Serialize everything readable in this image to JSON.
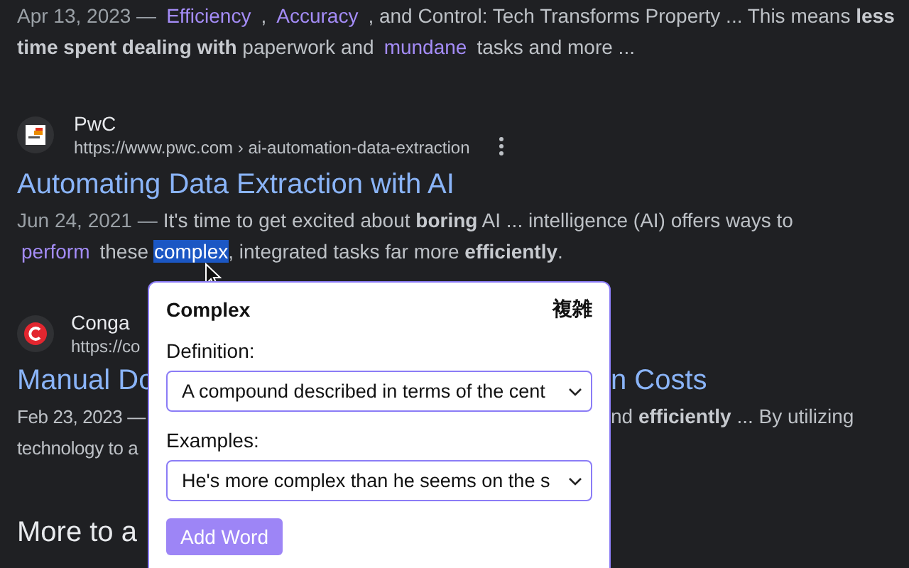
{
  "results": [
    {
      "kind": "snippet_only",
      "lines": [
        [
          {
            "kind": "date",
            "text": "Apr 13, 2023 —"
          },
          {
            "kind": "vocab",
            "text": "Efficiency"
          },
          {
            "kind": "text",
            "text": ","
          },
          {
            "kind": "vocab",
            "text": "Accuracy"
          },
          {
            "kind": "text",
            "text": ", and Control: Tech Transforms Property ... This means **less**"
          }
        ],
        [
          {
            "kind": "text",
            "text": "**time spent dealing with** paperwork and"
          },
          {
            "kind": "vocab",
            "text": "mundane"
          },
          {
            "kind": "text",
            "text": "tasks and more ..."
          }
        ]
      ]
    },
    {
      "kind": "full",
      "site": "PwC",
      "url": "https://www.pwc.com › ai-automation-data-extraction",
      "title": "Automating Data Extraction with AI",
      "lines": [
        [
          {
            "kind": "date",
            "text": "Jun 24, 2021 —"
          },
          {
            "kind": "text",
            "text": "It's time to get excited about **boring** AI ... intelligence (AI) offers ways to"
          }
        ],
        [
          {
            "kind": "vocab",
            "text": "perform"
          },
          {
            "kind": "text",
            "text": "these"
          },
          {
            "kind": "selected",
            "text": "complex"
          },
          {
            "kind": "text",
            "text": ", integrated tasks far more **efficiently**."
          }
        ]
      ]
    },
    {
      "kind": "covered",
      "site": "Conga",
      "url": "https://co",
      "title_parts": [
        "Manual Do",
        "n Costs"
      ],
      "lines": [
        {
          "left": "Feb 23, 2023 —",
          "right": "nd **efficiently** ... By utilizing"
        },
        {
          "left": "technology to a"
        }
      ]
    }
  ],
  "heading": "More to a",
  "popup": {
    "word": "Complex",
    "translation": "複雑",
    "definition_label": "Definition:",
    "definition_value": "A compound described in terms of the cent",
    "examples_label": "Examples:",
    "examples_value": "He's more complex than he seems on the s",
    "button": "Add Word"
  }
}
